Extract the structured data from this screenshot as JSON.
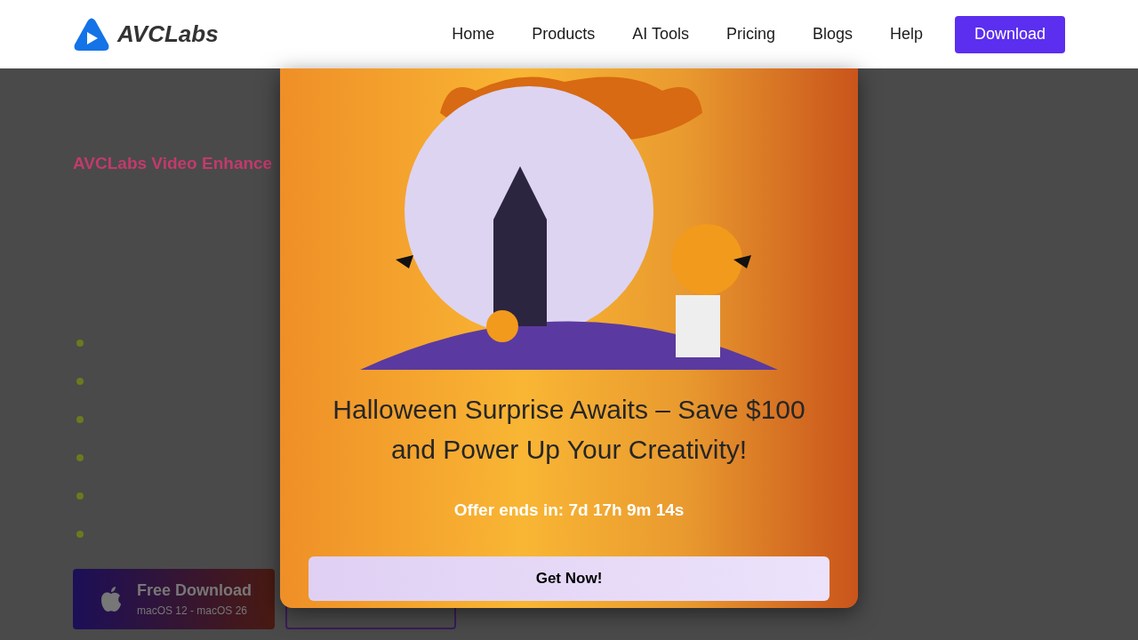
{
  "navbar": {
    "brand": "AVCLabs",
    "links": [
      {
        "label": "Home"
      },
      {
        "label": "Products"
      },
      {
        "label": "AI Tools"
      },
      {
        "label": "Pricing"
      },
      {
        "label": "Blogs"
      },
      {
        "label": "Help"
      }
    ],
    "cta": "Download"
  },
  "page": {
    "heading": "AVCLabs Video Enhance",
    "bullets": [
      {
        "kind": "dot"
      },
      {
        "kind": "dot"
      },
      {
        "kind": "dot"
      },
      {
        "kind": "dot"
      },
      {
        "kind": "dot"
      },
      {
        "kind": "dot"
      }
    ],
    "buttons": [
      {
        "kind": "apple",
        "label": "Free Download",
        "sublabel": "macOS 12 - macOS 26"
      },
      {
        "kind": "outline"
      }
    ]
  },
  "popup": {
    "headline": "Halloween Surprise Awaits – Save $100 and Power Up Your Creativity!",
    "countdown": "Offer ends in: 7d 17h 9m 14s",
    "button": "Get Now!"
  }
}
